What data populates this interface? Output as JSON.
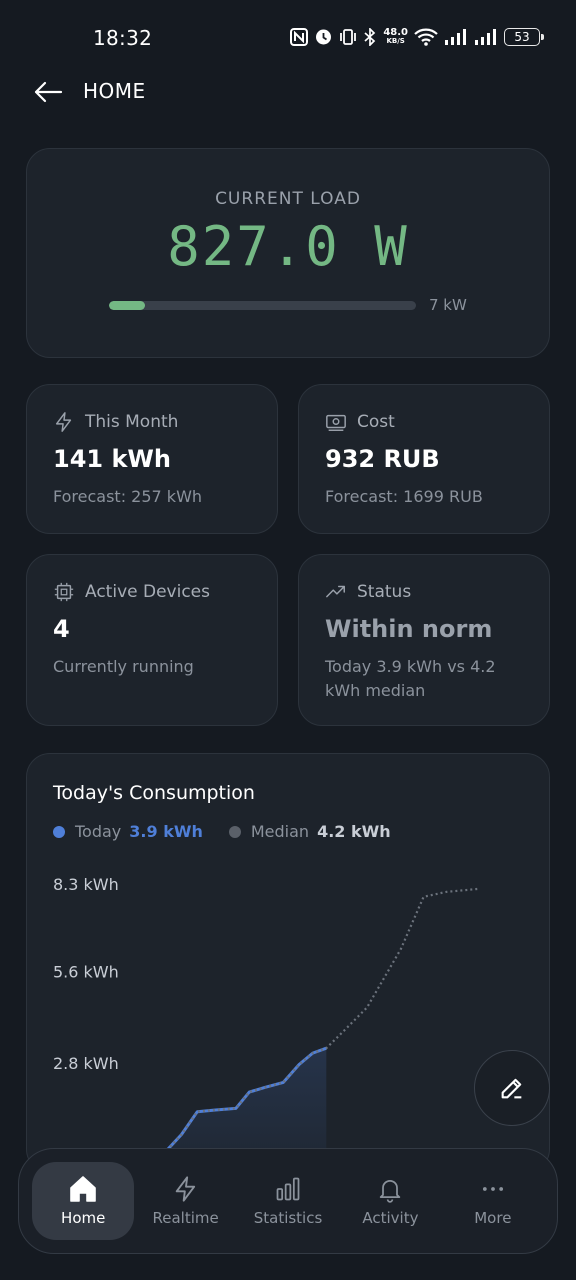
{
  "status_bar": {
    "time": "18:32",
    "net_speed_value": "48.0",
    "net_speed_unit": "KB/S",
    "battery": "53",
    "icons": [
      "nfc-icon",
      "alarm-icon",
      "vibrate-icon",
      "bluetooth-icon",
      "wifi-icon",
      "signal-icon",
      "signal-icon",
      "battery-icon"
    ]
  },
  "header": {
    "title": "HOME",
    "back_icon": "arrow-left-icon"
  },
  "current_load": {
    "label": "CURRENT LOAD",
    "value": "827.0 W",
    "progress_fraction": 0.118,
    "max_label": "7 kW",
    "color": "#74b884"
  },
  "stats": {
    "this_month": {
      "label": "This Month",
      "value": "141 kWh",
      "sub": "Forecast: 257 kWh",
      "icon": "lightning-icon"
    },
    "cost": {
      "label": "Cost",
      "value": "932 RUB",
      "sub": "Forecast: 1699 RUB",
      "icon": "money-icon"
    },
    "active_devices": {
      "label": "Active Devices",
      "value": "4",
      "sub": "Currently running",
      "icon": "chip-icon"
    },
    "status": {
      "label": "Status",
      "value": "Within norm",
      "sub": "Today 3.9 kWh vs 4.2 kWh median",
      "icon": "trending-up-icon"
    }
  },
  "chart": {
    "title": "Today's Consumption",
    "legend": [
      {
        "name": "Today",
        "value": "3.9 kWh",
        "color": "#4f7fd8"
      },
      {
        "name": "Median",
        "value": "4.2 kWh",
        "color": "#6b727c"
      }
    ]
  },
  "chart_data": {
    "type": "line",
    "title": "Today's Consumption",
    "ytick_values": [
      2.8,
      5.6,
      8.3
    ],
    "yticks": [
      "2.8 kWh",
      "5.6 kWh",
      "8.3 kWh"
    ],
    "ylim": [
      0,
      8.6
    ],
    "xlim": [
      0,
      24
    ],
    "series": [
      {
        "name": "Today",
        "color": "#4f7fd8",
        "x": [
          7.0,
          7.8,
          8.5,
          9.3,
          10.2,
          10.8,
          11.5,
          12.3,
          13.0,
          13.6,
          14.2
        ],
        "y": [
          0.0,
          0.6,
          1.3,
          1.35,
          1.4,
          1.9,
          2.05,
          2.2,
          2.75,
          3.1,
          3.25
        ]
      },
      {
        "name": "Median",
        "color": "#6b727c",
        "x": [
          7.0,
          7.8,
          8.5,
          9.3,
          10.2,
          10.8,
          11.5,
          12.3,
          13.0,
          13.6,
          14.2,
          15.0,
          16.0,
          17.5,
          18.5,
          19.5,
          21.0
        ],
        "y": [
          0.0,
          0.6,
          1.3,
          1.35,
          1.4,
          1.9,
          2.05,
          2.2,
          2.75,
          3.1,
          3.25,
          3.8,
          4.5,
          6.3,
          7.9,
          8.05,
          8.15
        ]
      }
    ],
    "grid": false,
    "legend_position": "top-left"
  },
  "fab": {
    "icon": "edit-icon"
  },
  "nav": [
    {
      "label": "Home",
      "icon": "home-icon",
      "active": true
    },
    {
      "label": "Realtime",
      "icon": "lightning-icon",
      "active": false
    },
    {
      "label": "Statistics",
      "icon": "bar-chart-icon",
      "active": false
    },
    {
      "label": "Activity",
      "icon": "bell-icon",
      "active": false
    },
    {
      "label": "More",
      "icon": "more-dots-icon",
      "active": false
    }
  ]
}
